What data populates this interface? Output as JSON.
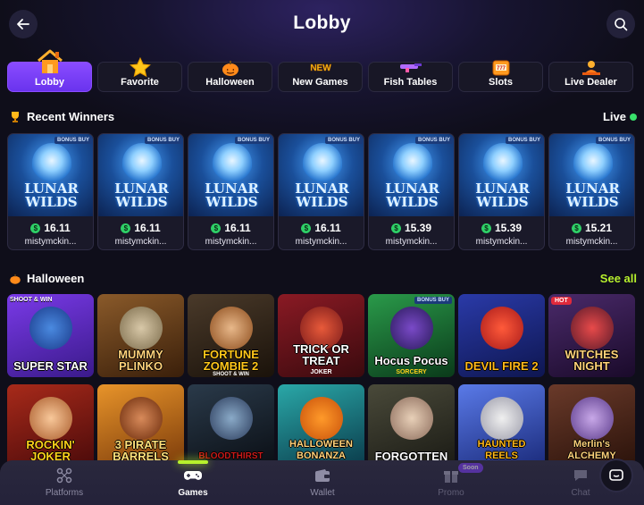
{
  "header": {
    "title": "Lobby"
  },
  "tabs": [
    {
      "label": "Lobby",
      "icon": "house-icon",
      "active": true
    },
    {
      "label": "Favorite",
      "icon": "star-icon",
      "active": false
    },
    {
      "label": "Halloween",
      "icon": "pumpkin-icon",
      "active": false
    },
    {
      "label": "New Games",
      "icon": "new-badge-icon",
      "active": false
    },
    {
      "label": "Fish Tables",
      "icon": "fish-gun-icon",
      "active": false
    },
    {
      "label": "Slots",
      "icon": "slot-machine-icon",
      "active": false
    },
    {
      "label": "Live Dealer",
      "icon": "dealer-icon",
      "active": false
    }
  ],
  "recent_winners": {
    "title": "Recent Winners",
    "live_label": "Live",
    "items": [
      {
        "game": "LUNAR WILDS",
        "badge": "BONUS BUY",
        "amount": "16.11",
        "user": "mistymckin..."
      },
      {
        "game": "LUNAR WILDS",
        "badge": "BONUS BUY",
        "amount": "16.11",
        "user": "mistymckin..."
      },
      {
        "game": "LUNAR WILDS",
        "badge": "BONUS BUY",
        "amount": "16.11",
        "user": "mistymckin..."
      },
      {
        "game": "LUNAR WILDS",
        "badge": "BONUS BUY",
        "amount": "16.11",
        "user": "mistymckin..."
      },
      {
        "game": "LUNAR WILDS",
        "badge": "BONUS BUY",
        "amount": "15.39",
        "user": "mistymckin..."
      },
      {
        "game": "LUNAR WILDS",
        "badge": "BONUS BUY",
        "amount": "15.39",
        "user": "mistymckin..."
      },
      {
        "game": "LUNAR WILDS",
        "badge": "BONUS BUY",
        "amount": "15.21",
        "user": "mistymckin..."
      }
    ]
  },
  "halloween": {
    "title": "Halloween",
    "see_all": "See all",
    "games": [
      {
        "name": "SUPER STAR",
        "tag": "SHOOT & WIN",
        "sub": "",
        "bg": "#5a2bb8"
      },
      {
        "name": "MUMMY PLINKO",
        "tag": "",
        "sub": "",
        "bg": "#6b3a1a"
      },
      {
        "name": "FORTUNE ZOMBIE 2",
        "tag": "",
        "sub": "SHOOT & WIN",
        "bg": "#3a2a1a"
      },
      {
        "name": "TRICK OR TREAT",
        "tag": "",
        "sub": "JOKER",
        "bg": "#5a0f18"
      },
      {
        "name": "Hocus Pocus",
        "tag": "BONUS BUY",
        "sub": "SORCERY",
        "bg": "#1f6a3a"
      },
      {
        "name": "DEVIL FIRE 2",
        "tag": "",
        "sub": "",
        "bg": "#1e2a7a"
      },
      {
        "name": "WITCHES NIGHT",
        "tag": "HOT",
        "sub": "",
        "bg": "#2a1540"
      },
      {
        "name": "ROCKIN' JOKER",
        "tag": "",
        "sub": "",
        "bg": "#8a1a1a"
      },
      {
        "name": "3 PIRATE BARRELS",
        "tag": "",
        "sub": "",
        "bg": "#b8641a"
      },
      {
        "name": "BLOODTHIRST",
        "tag": "",
        "sub": "",
        "bg": "#1a2a3a"
      },
      {
        "name": "HALLOWEEN BONANZA",
        "tag": "",
        "sub": "",
        "bg": "#1a6a6a"
      },
      {
        "name": "FORGOTTEN",
        "tag": "",
        "sub": "",
        "bg": "#2a2a2a"
      },
      {
        "name": "HAUNTED REELS",
        "tag": "",
        "sub": "",
        "bg": "#3a5ab8"
      },
      {
        "name": "Merlin's ALCHEMY",
        "tag": "",
        "sub": "",
        "bg": "#4a2a1a"
      }
    ]
  },
  "bottom_nav": [
    {
      "label": "Platforms",
      "icon": "platforms-icon",
      "active": false,
      "badge": ""
    },
    {
      "label": "Games",
      "icon": "gamepad-icon",
      "active": true,
      "badge": ""
    },
    {
      "label": "Wallet",
      "icon": "wallet-icon",
      "active": false,
      "badge": ""
    },
    {
      "label": "Promo",
      "icon": "gift-icon",
      "active": false,
      "badge": "Soon"
    },
    {
      "label": "Chat",
      "icon": "chat-icon",
      "active": false,
      "badge": ""
    }
  ],
  "colors": {
    "accent": "#8a4cff",
    "see_all": "#b7f02d",
    "live_dot": "#39e06b",
    "coin": "#2ed067"
  }
}
